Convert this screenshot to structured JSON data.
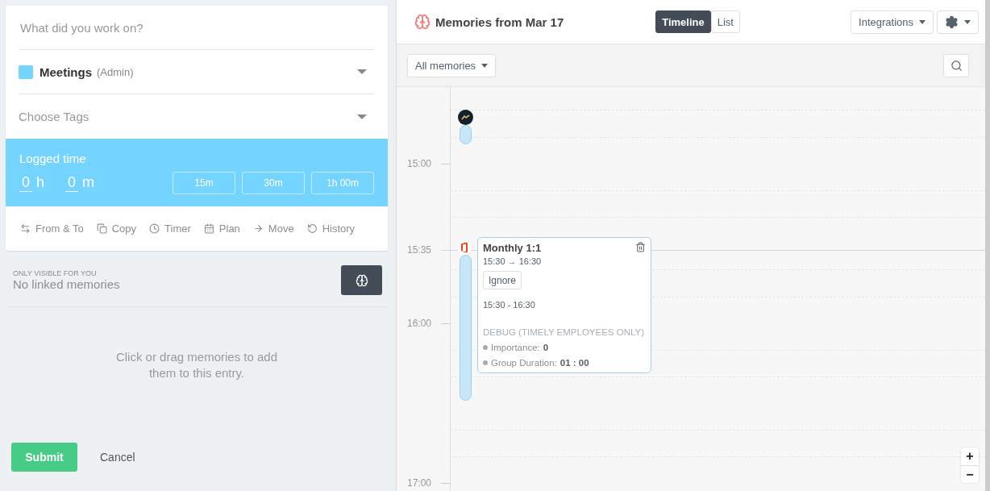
{
  "entry_form": {
    "description": {
      "placeholder": "What did you work on?"
    },
    "project": {
      "name": "Meetings",
      "client": "(Admin)",
      "color": "#75d4fd"
    },
    "tags": {
      "placeholder": "Choose Tags"
    },
    "logged_time": {
      "title": "Logged time",
      "hours": "0",
      "hours_unit": "h",
      "minutes": "0",
      "minutes_unit": "m",
      "presets": [
        "15m",
        "30m",
        "1h 00m"
      ]
    },
    "actions": [
      {
        "label": "From & To",
        "kind": "range"
      },
      {
        "label": "Copy",
        "kind": "copy"
      },
      {
        "label": "Timer",
        "kind": "timer"
      },
      {
        "label": "Plan",
        "kind": "plan"
      },
      {
        "label": "Move",
        "kind": "move"
      },
      {
        "label": "History",
        "kind": "history"
      }
    ]
  },
  "memories_panel": {
    "caption": "ONLY VISIBLE FOR YOU",
    "title": "No linked memories",
    "empty_hint": "Click or drag memories to add them to this entry."
  },
  "buttons": {
    "submit": "Submit",
    "cancel": "Cancel"
  },
  "timeline_view": {
    "title": "Memories from Mar 17",
    "view_tabs": [
      {
        "label": "Timeline",
        "selected": true
      },
      {
        "label": "List",
        "selected": false
      }
    ],
    "integrations": "Integrations",
    "filter": "All memories",
    "time_labels": [
      "15:00",
      "15:35",
      "16:00",
      "17:00"
    ],
    "memories": [
      {
        "kind": "app"
      },
      {
        "kind": "calendar",
        "title": "Monthly 1:1",
        "range": "15:30 → 16:30",
        "ignore": "Ignore",
        "time": "15:30 - 16:30",
        "debug_title": "DEBUG (TIMELY EMPLOYEES ONLY)",
        "debug_items": [
          {
            "label": "Importance:",
            "value": "0"
          },
          {
            "label": "Group Duration:",
            "value": "01 : 00"
          }
        ]
      }
    ],
    "zoom": [
      "+",
      "−"
    ]
  }
}
